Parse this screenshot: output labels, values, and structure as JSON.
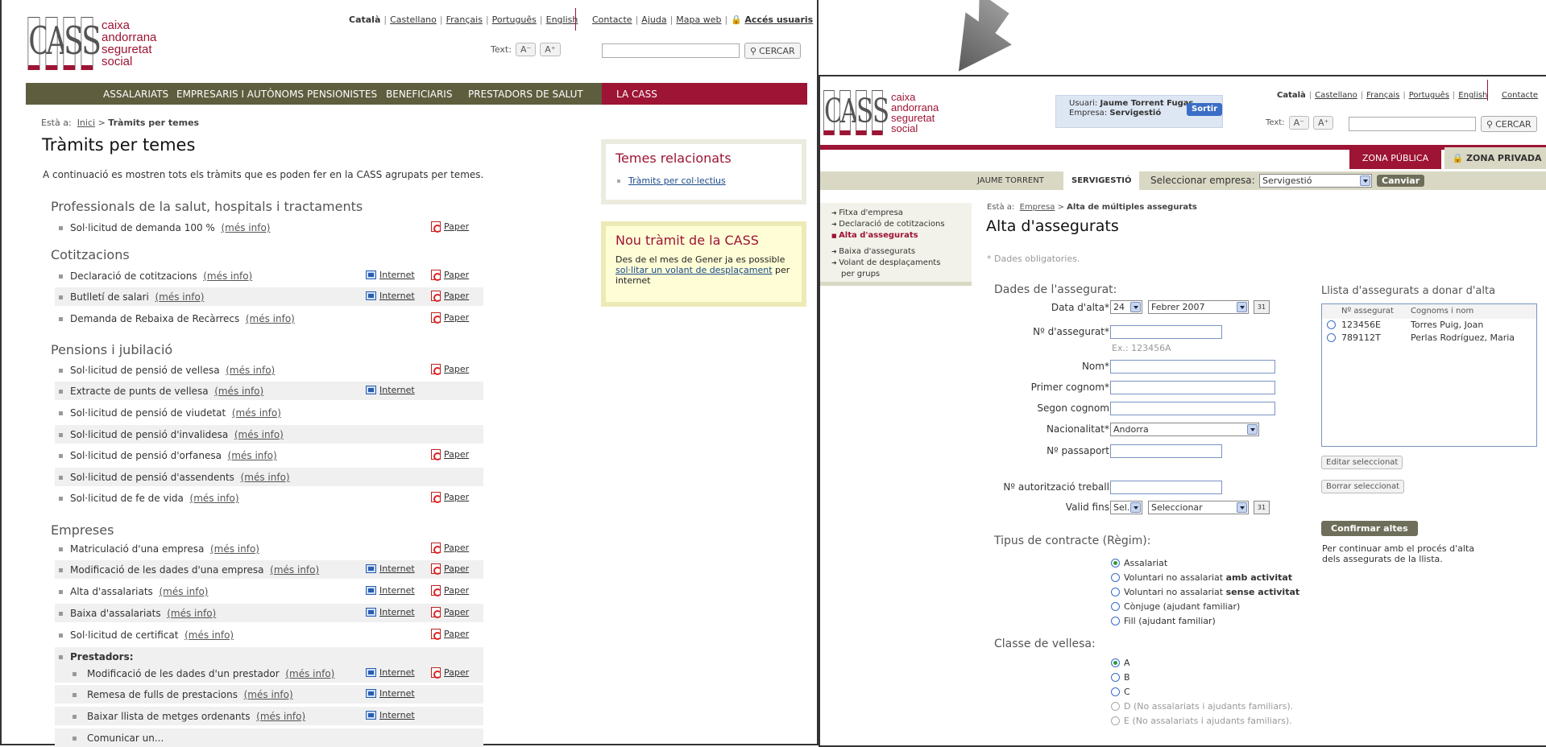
{
  "logo": {
    "letters": [
      "C",
      "A",
      "S",
      "S"
    ],
    "lines": [
      "caixa",
      "andorrana",
      "seguretat",
      "social"
    ]
  },
  "langs": [
    "Català",
    "Castellano",
    "Français",
    "Português",
    "English"
  ],
  "top_links": [
    "Contacte",
    "Ajuda",
    "Mapa web"
  ],
  "acces": "Accés usuaris",
  "text_label": "Text:",
  "text_minus": "A⁻",
  "text_plus": "A⁺",
  "search_btn": "CERCAR",
  "mainnav": [
    "ASSALARIATS",
    "EMPRESARIS I AUTÒNOMS",
    "PENSIONISTES",
    "BENEFICIARIS",
    "PRESTADORS DE SALUT",
    "LA CASS"
  ],
  "w1": {
    "bc_prefix": "Està a:",
    "bc_home": "Inici",
    "bc_sep": ">",
    "bc_cur": "Tràmits per temes",
    "title": "Tràmits per temes",
    "intro": "A continuació es mostren tots els tràmits que es poden fer en la CASS agrupats per temes.",
    "sections": [
      "Professionals de la salut, hospitals i tractaments",
      "Cotitzacions",
      "Pensions i jubilació",
      "Empreses"
    ],
    "mi": "(més info)",
    "internet": "Internet",
    "paper": "Paper",
    "rows": [
      {
        "l": "Sol·licitud de demanda 100 %"
      },
      {
        "l": "Declaració de cotitzacions"
      },
      {
        "l": "Butlletí de salari"
      },
      {
        "l": "Demanda de Rebaixa de Recàrrecs"
      },
      {
        "l": "Sol·licitud de pensió de vellesa"
      },
      {
        "l": "Extracte de punts de vellesa"
      },
      {
        "l": "Sol·licitud de pensió de viudetat"
      },
      {
        "l": "Sol·licitud de pensió d'invalidesa"
      },
      {
        "l": "Sol·licitud de pensió d'orfanesa"
      },
      {
        "l": "Sol·licitud de pensió d'assendents"
      },
      {
        "l": "Sol·licitud de fe de vida"
      },
      {
        "l": "Matriculació d'una empresa"
      },
      {
        "l": "Modificació de les dades d'una empresa"
      },
      {
        "l": "Alta d'assalariats"
      },
      {
        "l": "Baixa d'assalariats"
      },
      {
        "l": "Sol·licitud de certificat"
      },
      {
        "l": "Prestadors:"
      },
      {
        "l": "Modificació de les dades d'un prestador"
      },
      {
        "l": "Remesa de fulls de prestacions"
      },
      {
        "l": "Baixar llista de metges ordenants"
      },
      {
        "l": "Comunicar un..."
      }
    ],
    "related_title": "Temes relacionats",
    "related_link": "Tràmits per col·lectius",
    "new_title": "Nou tràmit de la CASS",
    "new_p1": "Des de el mes de Gener ja es possible ",
    "new_link": "sol·litar un volant de desplaçament",
    "new_p2": " per internet"
  },
  "w2": {
    "user_label": "Usuari:",
    "user_name": "Jaume Torrent Fugas",
    "emp_label": "Empresa:",
    "emp_name": "Servigestió",
    "sortir": "Sortir",
    "zona_publica": "ZONA PÚBLICA",
    "zona_privada": "ZONA PRIVADA",
    "sub_user": "JAUME TORRENT",
    "sub_emp": "SERVIGESTIÓ",
    "sel_emp_label": "Seleccionar empresa:",
    "sel_emp_value": "Servigestió",
    "canviar": "Canviar",
    "lnav": [
      "Fitxa d'empresa",
      "Declaració de cotitzacions",
      "Alta d'assegurats",
      "Baixa d'assegurats",
      "Volant de desplaçaments",
      "per grups"
    ],
    "bc_prefix": "Està a:",
    "bc_emp": "Empresa",
    "bc_cur": "Alta de múltiples assegurats",
    "title": "Alta d'assegurats",
    "oblig": "* Dades obligatories.",
    "dades": "Dades de l'assegurat:",
    "f_data": "Data d'alta*:",
    "f_day": "24",
    "f_month": "Febrer 2007",
    "f_nass": "Nº d'assegurat*:",
    "f_ex": "Ex.: 123456A",
    "f_nom": "Nom*:",
    "f_c1": "Primer cognom*:",
    "f_c2": "Segon cognom:",
    "f_nac": "Nacionalitat*:",
    "f_nac_val": "Andorra",
    "f_pass": "Nº passaport:",
    "f_aut": "Nº autorització treball:",
    "f_valid": "Valid fins:",
    "f_sel": "Sel.",
    "f_seleccionar": "Seleccionar",
    "tipus": "Tipus de contracte (Règim):",
    "r_tipus": [
      {
        "a": "Assalariat",
        "b": ""
      },
      {
        "a": "Voluntari no assalariat ",
        "b": "amb activitat"
      },
      {
        "a": "Voluntari no assalariat ",
        "b": "sense activitat"
      },
      {
        "a": "Cònjuge (ajudant familiar)",
        "b": ""
      },
      {
        "a": "Fill (ajudant familiar)",
        "b": ""
      }
    ],
    "classe": "Classe de vellesa:",
    "r_classe": [
      "A",
      "B",
      "C",
      "D (No assalariats i ajudants familiars).",
      "E (No assalariats i ajudants familiars)."
    ],
    "llista": "Llista d'assegurats a donar d'alta",
    "col1": "Nº assegurat",
    "col2": "Cognoms i nom",
    "list_rows": [
      {
        "n": "123456E",
        "nom": "Torres Puig, Joan"
      },
      {
        "n": "789112T",
        "nom": "Perlas Rodríguez, Maria"
      }
    ],
    "editar": "Editar seleccionat",
    "borrar": "Borrar seleccionat",
    "confirmar": "Confirmar altes",
    "continuar": "Per continuar amb el procés d'alta dels assegurats de la llista."
  }
}
